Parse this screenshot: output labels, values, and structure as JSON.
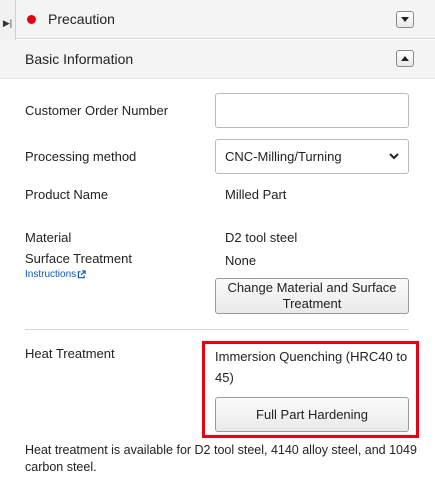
{
  "side_tab": {
    "icon": "collapse-panel-icon"
  },
  "precaution": {
    "title": "Precaution",
    "indicator_color": "#e60012",
    "toggle_icon": "chevron-down-icon"
  },
  "basic_info": {
    "title": "Basic Information",
    "toggle_icon": "chevron-up-icon"
  },
  "fields": {
    "customer_order_number": {
      "label": "Customer Order Number",
      "value": ""
    },
    "processing_method": {
      "label": "Processing method",
      "selected": "CNC-Milling/Turning"
    },
    "product_name": {
      "label": "Product Name",
      "value": "Milled Part"
    },
    "material": {
      "label": "Material",
      "value": "D2 tool steel"
    },
    "surface_treatment": {
      "label": "Surface Treatment",
      "value": "None",
      "link": "Instructions"
    }
  },
  "change_button": {
    "label": "Change Material and Surface Treatment"
  },
  "heat_treatment": {
    "label": "Heat Treatment",
    "value": "Immersion Quenching (HRC40 to 45)",
    "button": "Full Part Hardening",
    "highlight_color": "#e60012"
  },
  "note": "Heat treatment is available for D2 tool steel, 4140 alloy steel, and 1049 carbon steel."
}
